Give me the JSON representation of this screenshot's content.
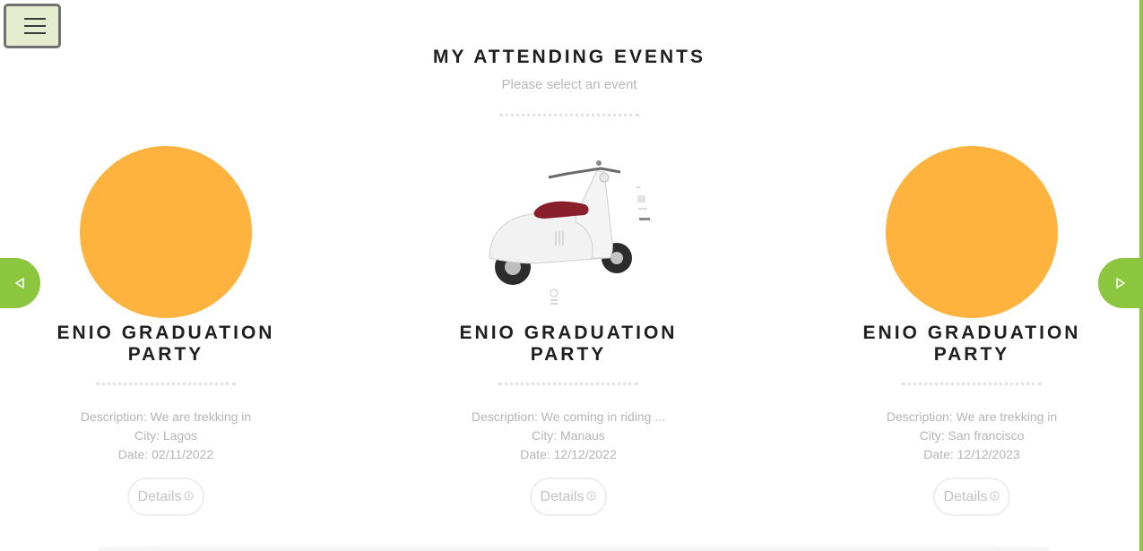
{
  "page": {
    "title": "MY ATTENDING EVENTS",
    "subtitle": "Please select an event"
  },
  "menu": {
    "icon": "hamburger-menu-icon"
  },
  "navigation": {
    "prev_icon": "triangle-left-icon",
    "next_icon": "triangle-right-icon",
    "accent_color": "#8cc63f"
  },
  "events": [
    {
      "title": "ENIO GRADUATION PARTY",
      "description": "Description: We are trekking in",
      "city": "City: Lagos",
      "date": "Date: 02/11/2022",
      "details_label": "Details",
      "image": "orange-circle-placeholder"
    },
    {
      "title": "ENIO GRADUATION PARTY",
      "description": "Description: We coming in riding ...",
      "city": "City: Manaus",
      "date": "Date: 12/12/2022",
      "details_label": "Details",
      "image": "white-scooter-photo"
    },
    {
      "title": "ENIO GRADUATION PARTY",
      "description": "Description: We are trekking in",
      "city": "City: San francisco",
      "date": "Date: 12/12/2023",
      "details_label": "Details",
      "image": "orange-circle-placeholder"
    }
  ],
  "colors": {
    "placeholder": "#ffb33f",
    "accent": "#8cc63f",
    "heading": "#1f1f1f",
    "muted_text": "#b5b5b5"
  }
}
